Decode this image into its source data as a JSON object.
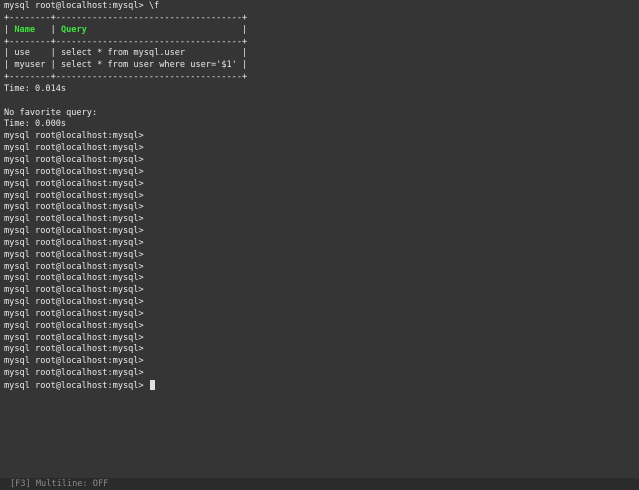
{
  "terminal": {
    "command_line": "mysql root@localhost:mysql> \\f",
    "table": {
      "border": "+--------+------------------------------------+",
      "headers": [
        "Name",
        "Query"
      ],
      "rows": [
        [
          "use",
          "select * from mysql.user"
        ],
        [
          "myuser",
          "select * from user where user='$1'"
        ]
      ]
    },
    "time1": "Time: 0.014s",
    "no_favorite": "No favorite query:",
    "time2": "Time: 0.000s",
    "prompt": "mysql root@localhost:mysql>",
    "empty_prompt_count": 21
  },
  "status_bar": {
    "text": "[F3] Multiline: OFF"
  }
}
